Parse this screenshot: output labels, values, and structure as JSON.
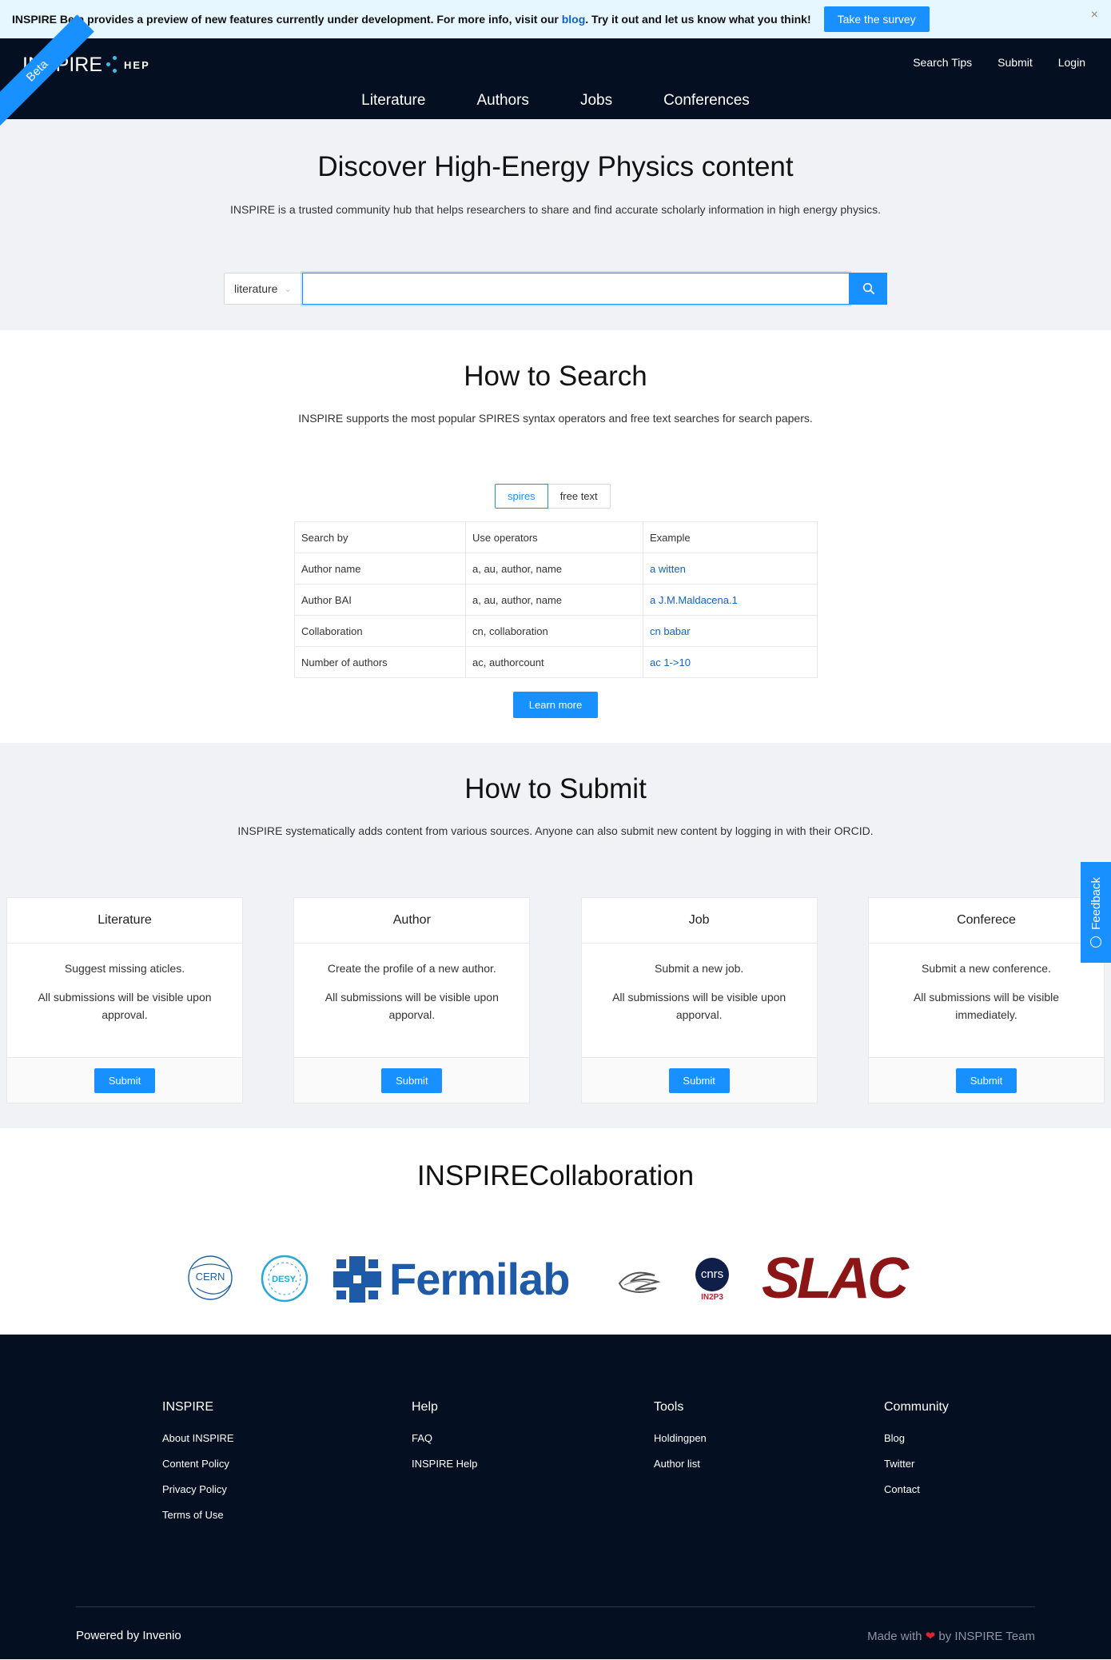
{
  "banner": {
    "brand": "INSPIRE",
    "text_rest": " Beta provides a preview of new features currently under development. For more info, visit our ",
    "link_text": "blog",
    "text_end": ". Try it out and let us know what you think!",
    "button_label": "Take the survey",
    "close_glyph": "×"
  },
  "header": {
    "ribbon": "Beta",
    "logo_text": "INSPIRE",
    "logo_suffix": "HEP",
    "right_links": [
      "Search Tips",
      "Submit",
      "Login"
    ],
    "nav": [
      "Literature",
      "Authors",
      "Jobs",
      "Conferences"
    ]
  },
  "hero": {
    "title": "Discover High-Energy Physics content",
    "subtitle": "INSPIRE is a trusted community hub that helps researchers to share and find accurate scholarly information in high energy physics.",
    "select_value": "literature",
    "search_value": ""
  },
  "how_search": {
    "title": "How to Search",
    "desc": "INSPIRE supports the most popular SPIRES syntax operators and free text searches for search papers.",
    "toggle": [
      "spires",
      "free text"
    ],
    "headers": [
      "Search by",
      "Use operators",
      "Example"
    ],
    "rows": [
      [
        "Author name",
        "a, au, author, name",
        "a witten"
      ],
      [
        "Author BAI",
        "a, au, author, name",
        "a J.M.Maldacena.1"
      ],
      [
        "Collaboration",
        "cn, collaboration",
        "cn babar"
      ],
      [
        "Number of authors",
        "ac, authorcount",
        "ac 1->10"
      ]
    ],
    "learn_more": "Learn more"
  },
  "how_submit": {
    "title": "How to Submit",
    "desc": "INSPIRE systematically adds content from various sources. Anyone can also submit new content by logging in with their ORCID.",
    "cards": [
      {
        "title": "Literature",
        "line1": "Suggest missing aticles.",
        "line2": "All submissions will be visible upon approval.",
        "button": "Submit"
      },
      {
        "title": "Author",
        "line1": "Create the profile of a new author.",
        "line2": "All submissions will be visible upon apporval.",
        "button": "Submit"
      },
      {
        "title": "Job",
        "line1": "Submit a new job.",
        "line2": "All submissions will be visible upon apporval.",
        "button": "Submit"
      },
      {
        "title": "Conferece",
        "line1": "Submit a new conference.",
        "line2": "All submissions will be visible immediately.",
        "button": "Submit"
      }
    ]
  },
  "feedback": "Feedback",
  "collab": {
    "title": "INSPIRECollaboration",
    "logos": {
      "cern": "CERN",
      "desy": "DESY.",
      "fermilab": "Fermilab",
      "cnrs": "cnrs",
      "in2p3": "IN2P3",
      "slac": "SLAC"
    }
  },
  "footer": {
    "columns": [
      {
        "title": "INSPIRE",
        "links": [
          "About INSPIRE",
          "Content Policy",
          "Privacy Policy",
          "Terms of Use"
        ]
      },
      {
        "title": "Help",
        "links": [
          "FAQ",
          "INSPIRE Help"
        ]
      },
      {
        "title": "Tools",
        "links": [
          "Holdingpen",
          "Author list"
        ]
      },
      {
        "title": "Community",
        "links": [
          "Blog",
          "Twitter",
          "Contact"
        ]
      }
    ],
    "powered_by": "Powered by Invenio",
    "made_with": "Made with",
    "heart": "❤",
    "by_team": "by INSPIRE Team"
  },
  "colors": {
    "primary": "#1890ff",
    "header_bg": "#050f22",
    "section_bg": "#f0f2f5",
    "link": "#1262c2",
    "fermilab_blue": "#1e5aa8",
    "slac_red": "#8c1515"
  }
}
